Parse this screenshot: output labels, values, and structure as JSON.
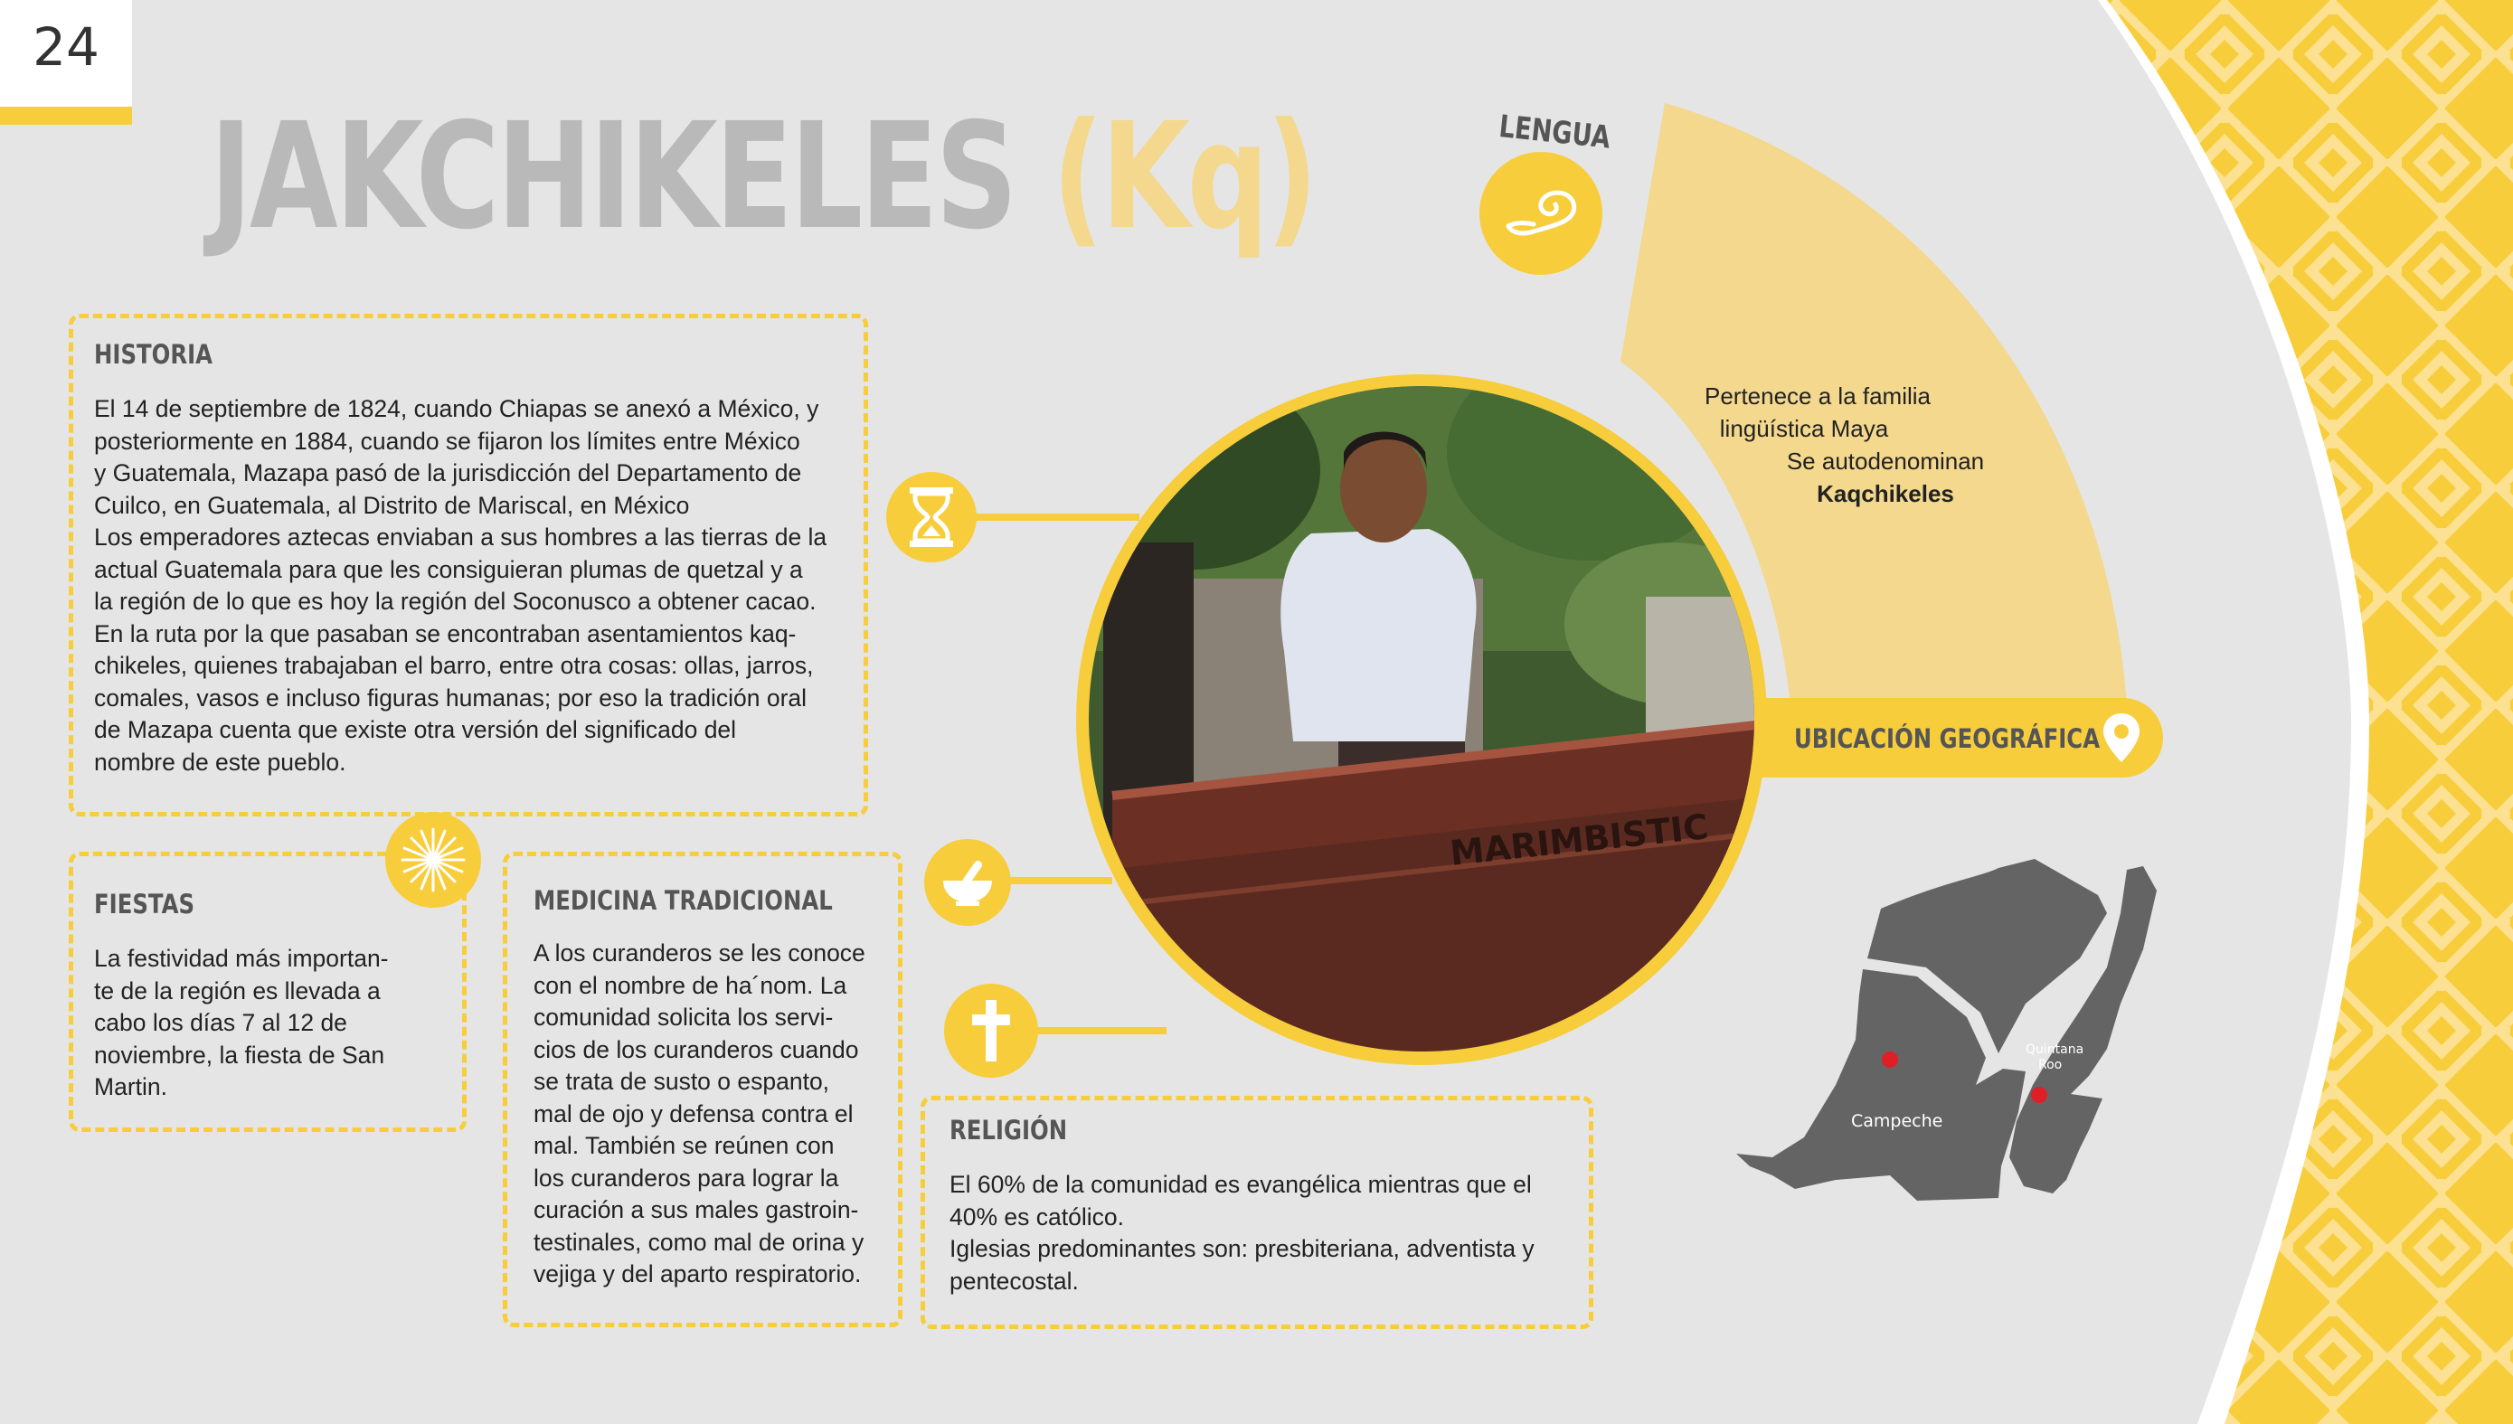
{
  "page": {
    "number": "24"
  },
  "title": {
    "main": "JAKCHIKELES",
    "code": "(Kq)"
  },
  "historia": {
    "heading": "HISTORIA",
    "text": "El 14 de septiembre de 1824, cuando Chiapas se anexó a México, y\nposteriormente en 1884, cuando se fijaron los límites entre México\ny Guatemala, Mazapa pasó de la jurisdicción del Departamento de\nCuilco, en Guatemala, al Distrito de Mariscal, en México\nLos emperadores aztecas enviaban a sus hombres a las tierras de la\nactual Guatemala para que les consiguieran plumas de quetzal y a\nla región de lo que es hoy la región del Soconusco a obtener cacao.\nEn la ruta por la que pasaban se encontraban asentamientos kaq-\nchikeles, quienes trabajaban el barro, entre otra cosas: ollas, jarros,\ncomales, vasos e incluso figuras humanas; por eso la tradición oral\nde Mazapa cuenta que existe otra versión del significado del\nnombre de este pueblo."
  },
  "fiestas": {
    "heading": "FIESTAS",
    "text": "La festividad más importan-\nte de la región es llevada a\ncabo los días 7 al 12 de\nnoviembre, la fiesta de San\nMartin."
  },
  "medicina": {
    "heading": "MEDICINA TRADICIONAL",
    "text": "A los curanderos se les conoce\ncon el nombre de ha´nom. La\ncomunidad solicita los servi-\ncios de los curanderos cuando\nse trata de susto o espanto,\nmal de ojo y defensa contra el\nmal. También se reúnen con\nlos curanderos para lograr la\ncuración a sus males gastroin-\ntestinales, como mal de orina y\nvejiga y del aparto respiratorio."
  },
  "religion": {
    "heading": "RELIGIÓN",
    "text": "El 60% de la comunidad es evangélica mientras que el\n40% es católico.\nIglesias predominantes son: presbiteriana, adventista y\npentecostal."
  },
  "lengua": {
    "heading": "LENGUA",
    "line1": "Pertenece a la familia",
    "line2": "lingüística Maya",
    "line3": "Se autodenominan",
    "name": "Kaqchikeles"
  },
  "ubicacion": {
    "label": "UBICACIÓN GEOGRÁFICA"
  },
  "photo": {
    "sign_text": "MARIMBISTIC"
  },
  "map": {
    "label_campeche": "Campeche",
    "label_qroo_1": "Quintana",
    "label_qroo_2": "Roo"
  },
  "colors": {
    "accent": "#f7cd3c",
    "accent_light": "#f3d88d",
    "heading_gray": "#b9b9b9",
    "map_gray": "#656465",
    "marker": "#e01e26"
  },
  "icons": {
    "historia": "hourglass-icon",
    "fiestas": "firework-icon",
    "medicina": "mortar-pestle-icon",
    "religion": "cross-icon",
    "lengua": "speech-swirl-icon",
    "ubicacion": "location-pin-icon"
  }
}
